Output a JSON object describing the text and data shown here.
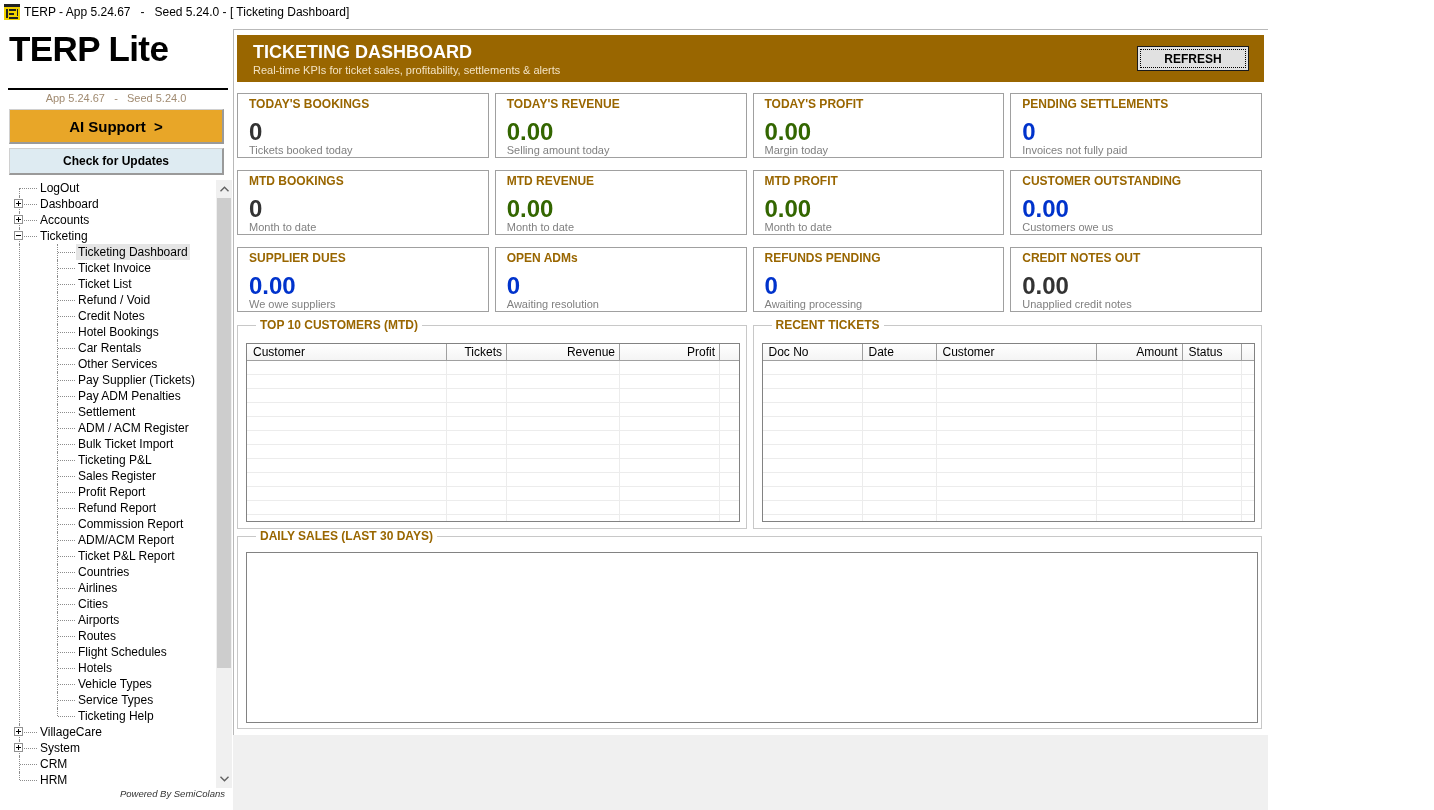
{
  "window": {
    "title": "TERP - App 5.24.67   -   Seed 5.24.0 - [ Ticketing Dashboard]"
  },
  "sidebar": {
    "brand": "TERP Lite",
    "version": "App 5.24.67   -   Seed 5.24.0",
    "ai_button": "AI Support  >",
    "update_button": "Check for Updates",
    "tree": [
      {
        "label": "LogOut",
        "selected": false
      },
      {
        "label": "Dashboard",
        "expanded": false,
        "selected": false
      },
      {
        "label": "Accounts",
        "expanded": false,
        "selected": false
      },
      {
        "label": "Ticketing",
        "expanded": true,
        "selected": false,
        "children": [
          {
            "label": "Ticketing Dashboard",
            "selected": true
          },
          {
            "label": "Ticket Invoice",
            "selected": false
          },
          {
            "label": "Ticket List",
            "selected": false
          },
          {
            "label": "Refund / Void",
            "selected": false
          },
          {
            "label": "Credit Notes",
            "selected": false
          },
          {
            "label": "Hotel Bookings",
            "selected": false
          },
          {
            "label": "Car Rentals",
            "selected": false
          },
          {
            "label": "Other Services",
            "selected": false
          },
          {
            "label": "Pay Supplier (Tickets)",
            "selected": false
          },
          {
            "label": "Pay ADM Penalties",
            "selected": false
          },
          {
            "label": "Settlement",
            "selected": false
          },
          {
            "label": "ADM / ACM Register",
            "selected": false
          },
          {
            "label": "Bulk Ticket Import",
            "selected": false
          },
          {
            "label": "Ticketing P&L",
            "selected": false
          },
          {
            "label": "Sales Register",
            "selected": false
          },
          {
            "label": "Profit Report",
            "selected": false
          },
          {
            "label": "Refund Report",
            "selected": false
          },
          {
            "label": "Commission Report",
            "selected": false
          },
          {
            "label": "ADM/ACM Report",
            "selected": false
          },
          {
            "label": "Ticket P&L Report",
            "selected": false
          },
          {
            "label": "Countries",
            "selected": false
          },
          {
            "label": "Airlines",
            "selected": false
          },
          {
            "label": "Cities",
            "selected": false
          },
          {
            "label": "Airports",
            "selected": false
          },
          {
            "label": "Routes",
            "selected": false
          },
          {
            "label": "Flight Schedules",
            "selected": false
          },
          {
            "label": "Hotels",
            "selected": false
          },
          {
            "label": "Vehicle Types",
            "selected": false
          },
          {
            "label": "Service Types",
            "selected": false
          },
          {
            "label": "Ticketing Help",
            "selected": false
          }
        ]
      },
      {
        "label": "VillageCare",
        "expanded": false,
        "selected": false
      },
      {
        "label": "System",
        "expanded": false,
        "selected": false
      },
      {
        "label": "CRM",
        "selected": false
      },
      {
        "label": "HRM",
        "selected": false
      }
    ],
    "footer": "Powered By SemiColans"
  },
  "header": {
    "title": "TICKETING DASHBOARD",
    "subtitle": "Real-time KPIs for ticket sales, profitability, settlements & alerts",
    "refresh_button": "REFRESH"
  },
  "kpis": [
    {
      "title": "TODAY'S BOOKINGS",
      "value": "0",
      "caption": "Tickets booked today",
      "color": "#333333"
    },
    {
      "title": "TODAY'S REVENUE",
      "value": "0.00",
      "caption": "Selling amount today",
      "color": "#336600"
    },
    {
      "title": "TODAY'S PROFIT",
      "value": "0.00",
      "caption": "Margin today",
      "color": "#336600"
    },
    {
      "title": "PENDING SETTLEMENTS",
      "value": "0",
      "caption": "Invoices not fully paid",
      "color": "#0033cc"
    },
    {
      "title": "MTD BOOKINGS",
      "value": "0",
      "caption": "Month to date",
      "color": "#333333"
    },
    {
      "title": "MTD REVENUE",
      "value": "0.00",
      "caption": "Month to date",
      "color": "#336600"
    },
    {
      "title": "MTD PROFIT",
      "value": "0.00",
      "caption": "Month to date",
      "color": "#336600"
    },
    {
      "title": "CUSTOMER OUTSTANDING",
      "value": "0.00",
      "caption": "Customers owe us",
      "color": "#0033cc"
    },
    {
      "title": "SUPPLIER DUES",
      "value": "0.00",
      "caption": "We owe suppliers",
      "color": "#0033cc"
    },
    {
      "title": "OPEN ADMs",
      "value": "0",
      "caption": "Awaiting resolution",
      "color": "#0033cc"
    },
    {
      "title": "REFUNDS PENDING",
      "value": "0",
      "caption": "Awaiting processing",
      "color": "#0033cc"
    },
    {
      "title": "CREDIT NOTES OUT",
      "value": "0.00",
      "caption": "Unapplied credit notes",
      "color": "#333333"
    }
  ],
  "panels": [
    {
      "title": "TOP 10 CUSTOMERS (MTD)",
      "columns": [
        {
          "label": "Customer",
          "kind": "text"
        },
        {
          "label": "Tickets",
          "kind": "number"
        },
        {
          "label": "Revenue",
          "kind": "number"
        },
        {
          "label": "Profit",
          "kind": "number"
        }
      ]
    },
    {
      "title": "RECENT TICKETS",
      "columns": [
        {
          "label": "Doc No",
          "kind": "text"
        },
        {
          "label": "Date",
          "kind": "text"
        },
        {
          "label": "Customer",
          "kind": "text"
        },
        {
          "label": "Amount",
          "kind": "number"
        },
        {
          "label": "Status",
          "kind": "text"
        }
      ]
    }
  ],
  "daily_sales": {
    "title": "DAILY SALES (LAST 30 DAYS)"
  }
}
